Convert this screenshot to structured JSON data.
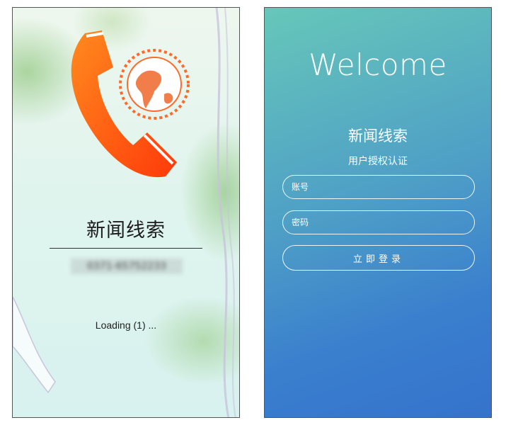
{
  "splash": {
    "title": "新闻线索",
    "phone_number": "0371-65752233",
    "loading_text": "Loading (1) ...",
    "icons": [
      "phone-handset-icon",
      "globe-icon"
    ],
    "colors": {
      "handset": "#ff5a14",
      "globe_ring": "#ff6a2a"
    }
  },
  "login": {
    "welcome": "Welcome",
    "title": "新闻线索",
    "subtitle": "用户授权认证",
    "account_placeholder": "账号",
    "password_placeholder": "密码",
    "submit_label": "立即登录",
    "colors": {
      "gradient_start": "#66c7b9",
      "gradient_end": "#3573cc"
    }
  }
}
